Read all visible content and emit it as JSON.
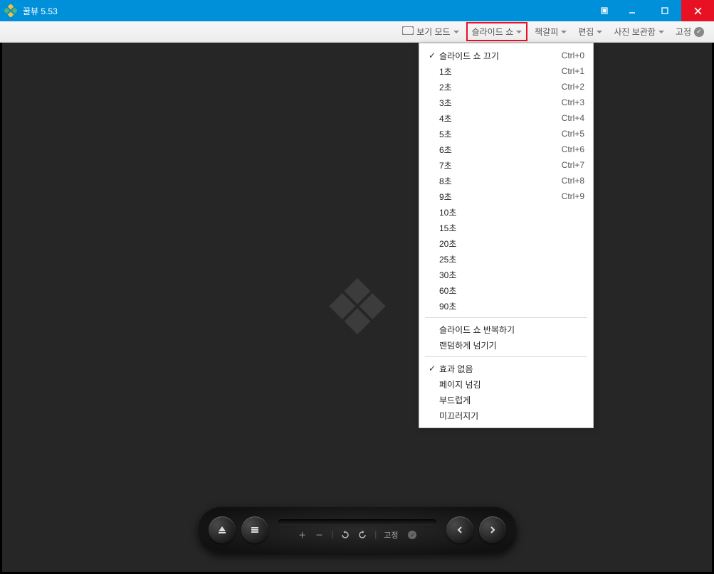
{
  "title": "꿀뷰 5.53",
  "toolbar": {
    "viewmode": "보기 모드",
    "slideshow": "슬라이드 쇼",
    "bookmark": "책갈피",
    "edit": "편집",
    "photostorage": "사진 보관함",
    "pin": "고정"
  },
  "dropdown": {
    "items_group1": [
      {
        "check": true,
        "label": "슬라이드 쇼 끄기",
        "shortcut": "Ctrl+0"
      },
      {
        "check": false,
        "label": "1초",
        "shortcut": "Ctrl+1"
      },
      {
        "check": false,
        "label": "2초",
        "shortcut": "Ctrl+2"
      },
      {
        "check": false,
        "label": "3초",
        "shortcut": "Ctrl+3"
      },
      {
        "check": false,
        "label": "4초",
        "shortcut": "Ctrl+4"
      },
      {
        "check": false,
        "label": "5초",
        "shortcut": "Ctrl+5"
      },
      {
        "check": false,
        "label": "6초",
        "shortcut": "Ctrl+6"
      },
      {
        "check": false,
        "label": "7초",
        "shortcut": "Ctrl+7"
      },
      {
        "check": false,
        "label": "8초",
        "shortcut": "Ctrl+8"
      },
      {
        "check": false,
        "label": "9초",
        "shortcut": "Ctrl+9"
      },
      {
        "check": false,
        "label": "10초",
        "shortcut": ""
      },
      {
        "check": false,
        "label": "15초",
        "shortcut": ""
      },
      {
        "check": false,
        "label": "20초",
        "shortcut": ""
      },
      {
        "check": false,
        "label": "25초",
        "shortcut": ""
      },
      {
        "check": false,
        "label": "30초",
        "shortcut": ""
      },
      {
        "check": false,
        "label": "60초",
        "shortcut": ""
      },
      {
        "check": false,
        "label": "90초",
        "shortcut": ""
      }
    ],
    "items_group2": [
      {
        "check": false,
        "label": "슬라이드 쇼 반복하기",
        "shortcut": ""
      },
      {
        "check": false,
        "label": "랜덤하게 넘기기",
        "shortcut": ""
      }
    ],
    "items_group3": [
      {
        "check": true,
        "label": "효과 없음",
        "shortcut": ""
      },
      {
        "check": false,
        "label": "페이지 넘김",
        "shortcut": ""
      },
      {
        "check": false,
        "label": "부드럽게",
        "shortcut": ""
      },
      {
        "check": false,
        "label": "미끄러지기",
        "shortcut": ""
      }
    ]
  },
  "controlbar": {
    "pin": "고정"
  }
}
